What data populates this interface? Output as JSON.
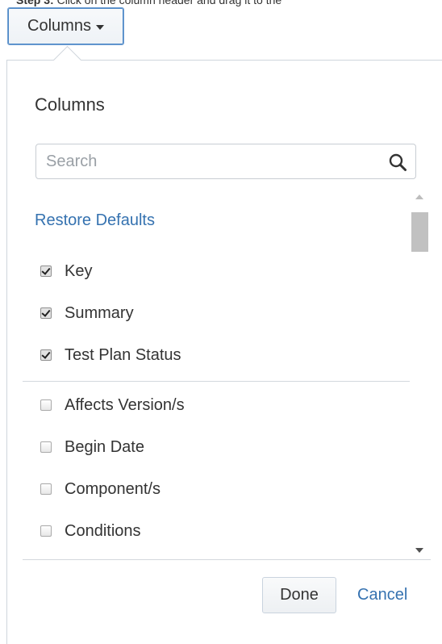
{
  "instruction": {
    "step_label": "Step 3:",
    "text": "Click on the column header and drag it to the"
  },
  "toggle": {
    "label": "Columns"
  },
  "dialog": {
    "title": "Columns",
    "search": {
      "placeholder": "Search",
      "value": ""
    },
    "restore_label": "Restore Defaults",
    "selected_items": [
      {
        "label": "Key",
        "checked": true
      },
      {
        "label": "Summary",
        "checked": true
      },
      {
        "label": "Test Plan Status",
        "checked": true
      }
    ],
    "available_items": [
      {
        "label": "Affects Version/s",
        "checked": false
      },
      {
        "label": "Begin Date",
        "checked": false
      },
      {
        "label": "Component/s",
        "checked": false
      },
      {
        "label": "Conditions",
        "checked": false
      }
    ],
    "done_label": "Done",
    "cancel_label": "Cancel"
  },
  "colors": {
    "link": "#3572b0",
    "text": "#333333",
    "border": "#c9d3de"
  }
}
